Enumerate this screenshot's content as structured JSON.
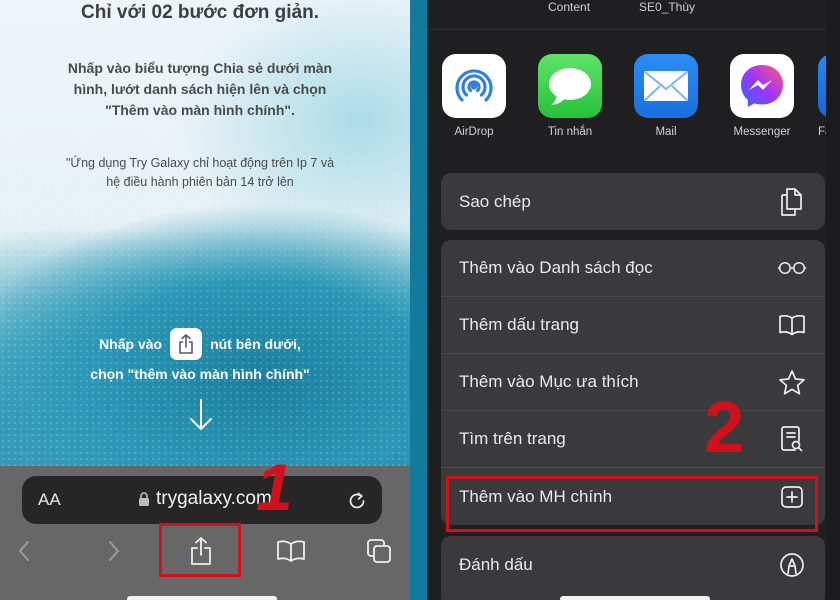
{
  "left_panel": {
    "title": "Chỉ với 02 bước đơn giản.",
    "instructions": [
      "Nhấp vào biểu tượng Chia sẻ dưới màn",
      "hình, lướt danh sách hiện lên và chọn",
      "\"Thêm vào màn hình chính\"."
    ],
    "note": [
      "\"Ứng dụng Try Galaxy chỉ hoạt động trên Ip 7 và",
      "hệ điều hành phiên bản 14 trở lên"
    ],
    "tap_prefix": "Nhấp vào",
    "tap_suffix": "nút bên dưới,",
    "tap_line2": "chọn \"thêm vào màn hình chính\"",
    "share_icon": "share-icon",
    "arrow_icon": "arrow-down-icon"
  },
  "safari": {
    "text_size_label": "AA",
    "url": "trygalaxy.com",
    "lock_icon": "lock-icon",
    "reload_icon": "reload-icon",
    "toolbar": [
      {
        "name": "back",
        "icon": "chevron-left-icon",
        "enabled": false
      },
      {
        "name": "forward",
        "icon": "chevron-right-icon",
        "enabled": false
      },
      {
        "name": "share",
        "icon": "share-icon",
        "enabled": true
      },
      {
        "name": "bookmarks",
        "icon": "book-icon",
        "enabled": true
      },
      {
        "name": "tabs",
        "icon": "tabs-icon",
        "enabled": true
      }
    ]
  },
  "annotations": {
    "step1": "1",
    "step2": "2",
    "highlight_color": "#d0111b"
  },
  "share_sheet": {
    "contacts": [
      "Content",
      "SE0_Thùy"
    ],
    "apps": [
      {
        "label": "AirDrop",
        "icon": "airdrop-icon"
      },
      {
        "label": "Tin nhắn",
        "icon": "messages-icon"
      },
      {
        "label": "Mail",
        "icon": "mail-icon"
      },
      {
        "label": "Messenger",
        "icon": "messenger-icon"
      },
      {
        "label": "Fa",
        "icon": "facebook-icon"
      }
    ],
    "group1": [
      {
        "label": "Sao chép",
        "icon": "copy-icon"
      }
    ],
    "group2": [
      {
        "label": "Thêm vào Danh sách đọc",
        "icon": "glasses-icon"
      },
      {
        "label": "Thêm dấu trang",
        "icon": "book-icon"
      },
      {
        "label": "Thêm vào Mục ưa thích",
        "icon": "star-icon"
      },
      {
        "label": "Tìm trên trang",
        "icon": "find-in-page-icon"
      },
      {
        "label": "Thêm vào MH chính",
        "icon": "add-square-icon",
        "highlighted": true
      }
    ],
    "group3": [
      {
        "label": "Đánh dấu",
        "icon": "markup-icon"
      }
    ]
  }
}
